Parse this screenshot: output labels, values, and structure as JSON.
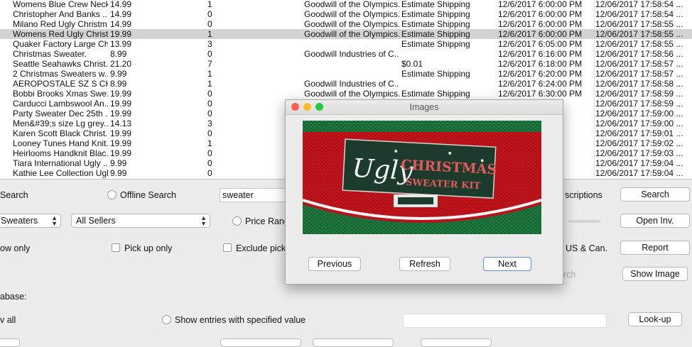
{
  "rows": [
    {
      "title": "Womens Blue Crew Neck...",
      "price": "14.99",
      "count": "1",
      "seller": "Goodwill of the Olympics...",
      "shipping": "Estimate Shipping",
      "end_time": "12/6/2017 6:00:00 PM",
      "added": "12/06/2017 17:58:54 ..."
    },
    {
      "title": "Christopher And Banks ...",
      "price": "14.99",
      "count": "0",
      "seller": "Goodwill of the Olympics...",
      "shipping": "Estimate Shipping",
      "end_time": "12/6/2017 6:00:00 PM",
      "added": "12/06/2017 17:58:54 ..."
    },
    {
      "title": "Milano Red Ugly Christm...",
      "price": "14.99",
      "count": "0",
      "seller": "Goodwill of the Olympics...",
      "shipping": "Estimate Shipping",
      "end_time": "12/6/2017 6:00:00 PM",
      "added": "12/06/2017 17:58:55 ..."
    },
    {
      "title": "Womens Red Ugly Christ...",
      "price": "19.99",
      "count": "1",
      "seller": "Goodwill of the Olympics...",
      "shipping": "Estimate Shipping",
      "end_time": "12/6/2017 6:00:00 PM",
      "added": "12/06/2017 17:58:55 ...",
      "selected": true
    },
    {
      "title": "Quaker Factory Large Ch...",
      "price": "13.99",
      "count": "3",
      "seller": "",
      "shipping": "Estimate Shipping",
      "end_time": "12/6/2017 6:05:00 PM",
      "added": "12/06/2017 17:58:55 ..."
    },
    {
      "title": "Christmas Sweater.",
      "price": "8.99",
      "count": "0",
      "seller": "Goodwill Industries of C...",
      "shipping": "",
      "end_time": "12/6/2017 6:16:00 PM",
      "added": "12/06/2017 17:58:56 ..."
    },
    {
      "title": "Seattle Seahawks Christ...",
      "price": "21.20",
      "count": "7",
      "seller": "",
      "shipping": "$0.01",
      "end_time": "12/6/2017 6:18:00 PM",
      "added": "12/06/2017 17:58:57 ..."
    },
    {
      "title": "2 Christmas Sweaters w...",
      "price": "9.99",
      "count": "1",
      "seller": "",
      "shipping": "Estimate Shipping",
      "end_time": "12/6/2017 6:20:00 PM",
      "added": "12/06/2017 17:58:57 ..."
    },
    {
      "title": "AEROPOSTALE SZ S CHRI...",
      "price": "8.99",
      "count": "1",
      "seller": "Goodwill Industries of C...",
      "shipping": "",
      "end_time": "12/6/2017 6:24:00 PM",
      "added": "12/06/2017 17:58:58 ..."
    },
    {
      "title": "Bobbi Brooks Xmas Swe...",
      "price": "19.99",
      "count": "0",
      "seller": "Goodwill of the Olympics...",
      "shipping": "Estimate Shipping",
      "end_time": "12/6/2017 6:30:00 PM",
      "added": "12/06/2017 17:58:59 ..."
    },
    {
      "title": "Carducci Lambswool An...",
      "price": "19.99",
      "count": "0",
      "seller": "",
      "shipping": "",
      "end_time": "00 PM",
      "added": "12/06/2017 17:58:59 ..."
    },
    {
      "title": "Party Sweater Dec 25th ...",
      "price": "19.99",
      "count": "0",
      "seller": "",
      "shipping": "",
      "end_time": "00 PM",
      "added": "12/06/2017 17:59:00 ..."
    },
    {
      "title": "Men&#39;s size Lg grey...",
      "price": "14.13",
      "count": "3",
      "seller": "",
      "shipping": "",
      "end_time": "00 PM",
      "added": "12/06/2017 17:59:00 ..."
    },
    {
      "title": "Karen Scott Black Christ...",
      "price": "19.99",
      "count": "0",
      "seller": "",
      "shipping": "",
      "end_time": "00 PM",
      "added": "12/06/2017 17:59:01 ..."
    },
    {
      "title": "Looney Tunes Hand Knit...",
      "price": "19.99",
      "count": "1",
      "seller": "",
      "shipping": "",
      "end_time": "00 PM",
      "added": "12/06/2017 17:59:02 ..."
    },
    {
      "title": "Heirlooms Handknit Blac...",
      "price": "19.99",
      "count": "0",
      "seller": "",
      "shipping": "",
      "end_time": "00 PM",
      "added": "12/06/2017 17:59:03 ..."
    },
    {
      "title": "Tiara International Ugly ...",
      "price": "9.99",
      "count": "0",
      "seller": "",
      "shipping": "",
      "end_time": "00 PM",
      "added": "12/06/2017 17:59:04 ..."
    },
    {
      "title": "Kathie Lee Collection Ugl...",
      "price": "9.99",
      "count": "0",
      "seller": "",
      "shipping": "",
      "end_time": "00 PM",
      "added": "12/06/2017 17:59:04 ..."
    }
  ],
  "controls": {
    "search_label": "Search",
    "offline_search_label": "Offline Search",
    "query_value": "sweater",
    "descriptions_label": "scriptions",
    "search_button": "Search",
    "category_value": "Sweaters",
    "sellers_value": "All Sellers",
    "price_range_label": "Price Rang",
    "open_inv_button": "Open Inv.",
    "now_only_label": "ow only",
    "pickup_only_label": "Pick up only",
    "exclude_label": "Exclude pick",
    "us_can_label": "US & Can.",
    "report_button": "Report",
    "search_faded": "rch",
    "show_image_button": "Show Image",
    "database_label": "abase:",
    "show_all_label": "v all",
    "show_entries_label": "Show entries with specified value",
    "lookup_button": "Look-up"
  },
  "dialog": {
    "title": "Images",
    "image_alt": "Ugly Christmas Sweater Kit label on red knit sweater",
    "image_text_1": "Ugly",
    "image_text_2": "CHRISTMAS",
    "image_text_3": "SWEATER KIT",
    "previous_button": "Previous",
    "refresh_button": "Refresh",
    "next_button": "Next"
  },
  "colors": {
    "selected_row": "#d3d3d3",
    "close": "#fc5f57",
    "minimize": "#fdbc2e",
    "zoom": "#28c840",
    "default_button_border": "#5a8ee0"
  }
}
